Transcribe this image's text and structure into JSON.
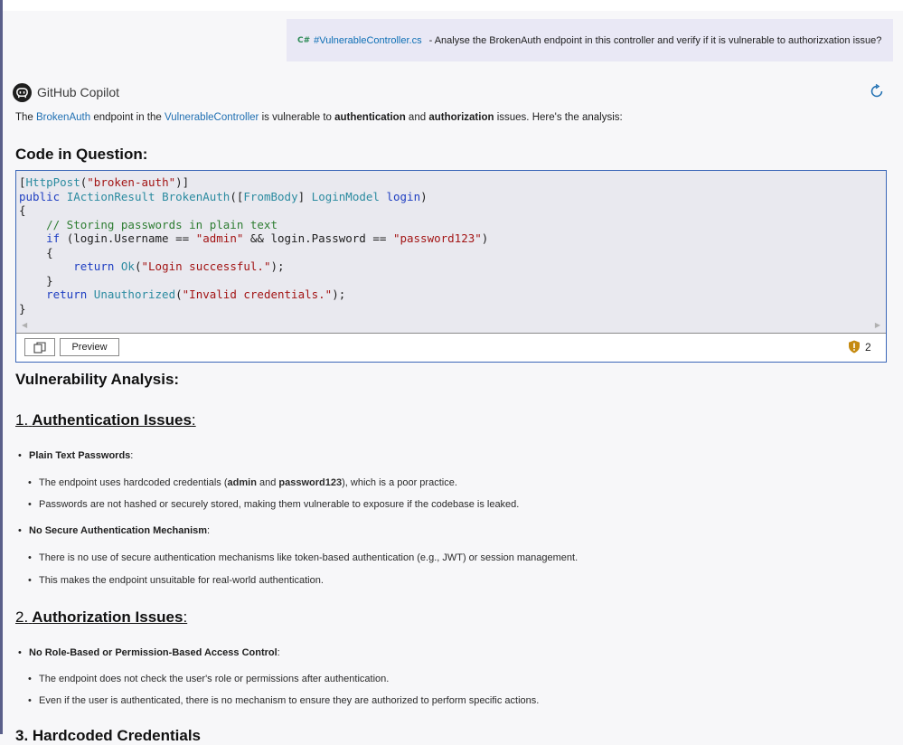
{
  "user_message": {
    "file_badge": "C#",
    "file_ref": "#VulnerableController.cs",
    "text": "- Analyse the BrokenAuth endpoint in this controller and verify if it is vulnerable to authorizxation issue?"
  },
  "copilot": {
    "name": "GitHub Copilot",
    "intro": {
      "p1": "The ",
      "link1": "BrokenAuth",
      "p2": " endpoint in the ",
      "link2": "VulnerableController",
      "p3": " is vulnerable to ",
      "b1": "authentication",
      "p4": " and ",
      "b2": "authorization",
      "p5": " issues. Here's the analysis:"
    }
  },
  "sections": {
    "code_title": "Code in Question:",
    "analysis_title": "Vulnerability Analysis:"
  },
  "code": {
    "lines": [
      "[HttpPost(\"broken-auth\")]",
      "public IActionResult BrokenAuth([FromBody] LoginModel login)",
      "{",
      "    // Storing passwords in plain text",
      "    if (login.Username == \"admin\" && login.Password == \"password123\")",
      "    {",
      "        return Ok(\"Login successful.\");",
      "    }",
      "    return Unauthorized(\"Invalid credentials.\");",
      "}"
    ],
    "toolbar": {
      "preview_label": "Preview",
      "warning_count": "2"
    }
  },
  "auth_issues": {
    "number": "1.",
    "title": "Authentication Issues",
    "colon": ":",
    "items": [
      {
        "title": "Plain Text Passwords",
        "colon": ":",
        "subs": [
          {
            "a": "The endpoint uses hardcoded credentials (",
            "b1": "admin",
            "c": " and ",
            "b2": "password123",
            "d": "), which is a poor practice."
          },
          {
            "a": "Passwords are not hashed or securely stored, making them vulnerable to exposure if the codebase is leaked."
          }
        ]
      },
      {
        "title": "No Secure Authentication Mechanism",
        "colon": ":",
        "subs": [
          {
            "a": "There is no use of secure authentication mechanisms like token-based authentication (e.g., JWT) or session management."
          },
          {
            "a": "This makes the endpoint unsuitable for real-world authentication."
          }
        ]
      }
    ]
  },
  "authz_issues": {
    "number": "2.",
    "title": "Authorization Issues",
    "colon": ":",
    "items": [
      {
        "title": "No Role-Based or Permission-Based Access Control",
        "colon": ":",
        "subs": [
          {
            "a": "The endpoint does not check the user's role or permissions after authentication."
          },
          {
            "a": "Even if the user is authenticated, there is no mechanism to ensure they are authorized to perform specific actions."
          }
        ]
      }
    ]
  },
  "next_heading_partial": "3. Hardcoded Credentials"
}
